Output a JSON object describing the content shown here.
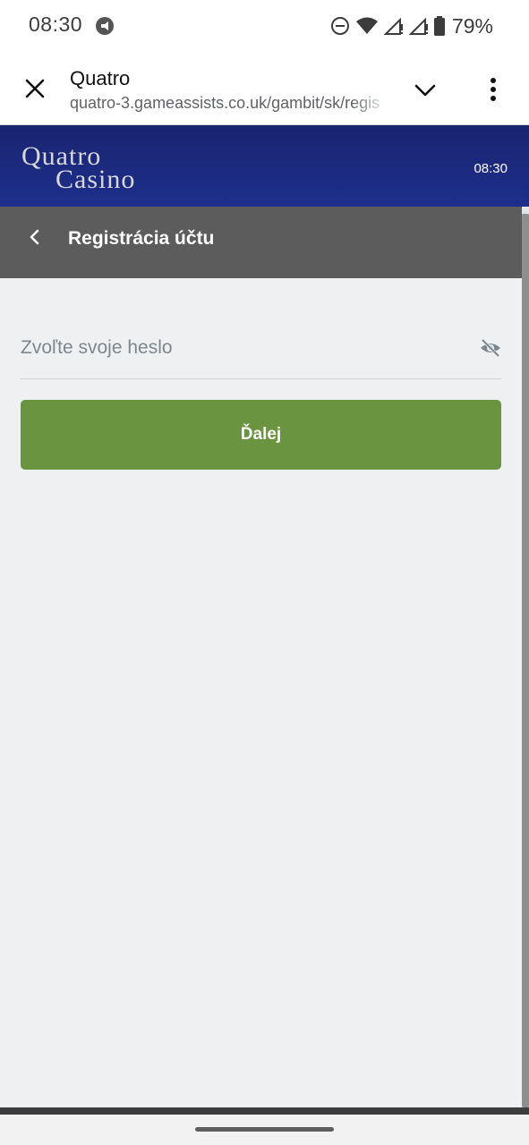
{
  "status_bar": {
    "time": "08:30",
    "battery": "79%",
    "icons": [
      "app-notification-icon",
      "do-not-disturb-icon",
      "wifi-icon",
      "signal-icon",
      "signal-icon",
      "battery-icon"
    ]
  },
  "browser": {
    "site_title": "Quatro",
    "url": "quatro-3.gameassists.co.uk/gambit/sk/regis",
    "icons": [
      "close-icon",
      "chevron-down-icon",
      "more-vert-icon"
    ]
  },
  "header": {
    "logo_line1": "Quatro",
    "logo_line2": "Casino",
    "time": "08:30",
    "colors": {
      "header_bg": "#1d2f8c"
    }
  },
  "page": {
    "title": "Registrácia účtu",
    "back_icon": "chevron-left-icon"
  },
  "form": {
    "password_placeholder": "Zvoľte svoje heslo",
    "password_value": "",
    "visibility_icon": "eye-off-icon",
    "next_label": "Ďalej",
    "colors": {
      "button_bg": "#6a9440",
      "content_bg": "#eef0f2",
      "title_bar_bg": "#5c5c5c"
    }
  }
}
